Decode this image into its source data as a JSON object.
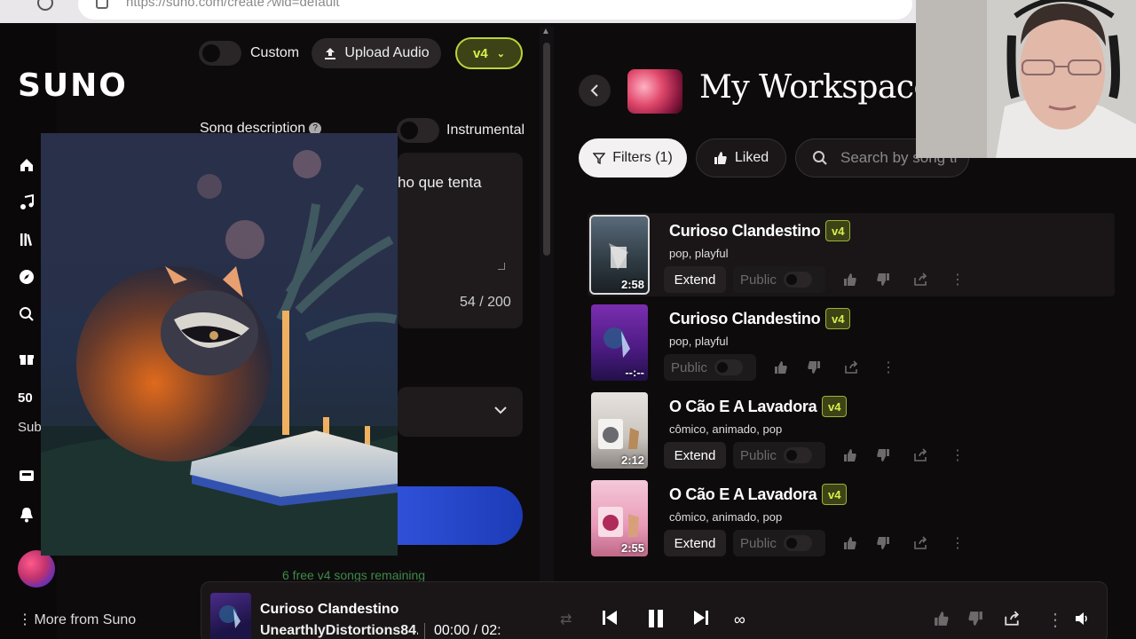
{
  "browser": {
    "url": "https://suno.com/create?wid=default"
  },
  "sidebar": {
    "logo": "SUNO",
    "nav_icons": [
      "home-icon",
      "music-note-icon",
      "library-icon",
      "explore-icon",
      "search-icon",
      "gift-icon"
    ],
    "credits": "50",
    "subscribe": "Sub",
    "more_label": "More from Suno"
  },
  "create": {
    "custom_label": "Custom",
    "upload_label": "Upload Audio",
    "model_selected": "v4",
    "song_description_label": "Song description",
    "instrumental_label": "Instrumental",
    "description_text": "ho que tenta",
    "char_counter": "54 / 200",
    "free_note": "6 free v4 songs remaining"
  },
  "workspace": {
    "title": "My Workspace",
    "filters_label": "Filters (1)",
    "liked_label": "Liked",
    "search_placeholder": "Search by song ti",
    "songs": [
      {
        "title": "Curioso Clandestino",
        "tag": "v4",
        "tags": "pop, playful",
        "duration": "2:58",
        "extend": "Extend",
        "public": "Public"
      },
      {
        "title": "Curioso Clandestino",
        "tag": "v4",
        "tags": "pop, playful",
        "duration": "--:--",
        "extend": "",
        "public": "Public"
      },
      {
        "title": "O Cão E A Lavadora",
        "tag": "v4",
        "tags": "cômico, animado, pop",
        "duration": "2:12",
        "extend": "Extend",
        "public": "Public"
      },
      {
        "title": "O Cão E A Lavadora",
        "tag": "v4",
        "tags": "cômico, animado, pop",
        "duration": "2:55",
        "extend": "Extend",
        "public": "Public"
      }
    ]
  },
  "player": {
    "title": "Curioso Clandestino",
    "artist": "UnearthlyDistortions84...",
    "time": "00:00 / 02:"
  },
  "colors": {
    "accent_green": "#d6f24a",
    "create_blue": "#2f51d8",
    "background": "#0e0b0c"
  }
}
